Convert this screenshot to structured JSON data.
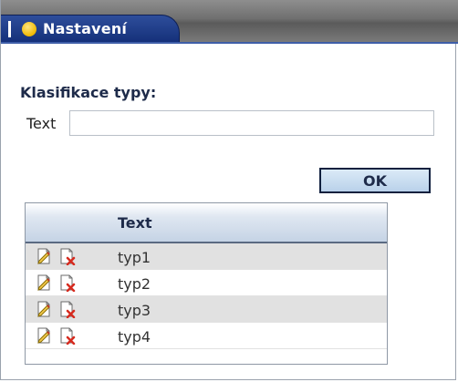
{
  "window": {
    "title": "Nastavení"
  },
  "form": {
    "section_label": "Klasifikace typy:",
    "text_label": "Text",
    "text_value": "",
    "ok_label": "OK"
  },
  "grid": {
    "column_text": "Text",
    "rows": [
      {
        "text": "typ1",
        "edit_icon": "edit-icon",
        "delete_icon": "delete-icon"
      },
      {
        "text": "typ2",
        "edit_icon": "edit-icon",
        "delete_icon": "delete-icon"
      },
      {
        "text": "typ3",
        "edit_icon": "edit-icon",
        "delete_icon": "delete-icon"
      },
      {
        "text": "typ4",
        "edit_icon": "edit-icon",
        "delete_icon": "delete-icon"
      }
    ]
  },
  "colors": {
    "tab_background": "#1f3c8a",
    "title_dot": "#f0b800",
    "row_alternate": "#e1e1e1",
    "ok_border": "#10203e"
  }
}
